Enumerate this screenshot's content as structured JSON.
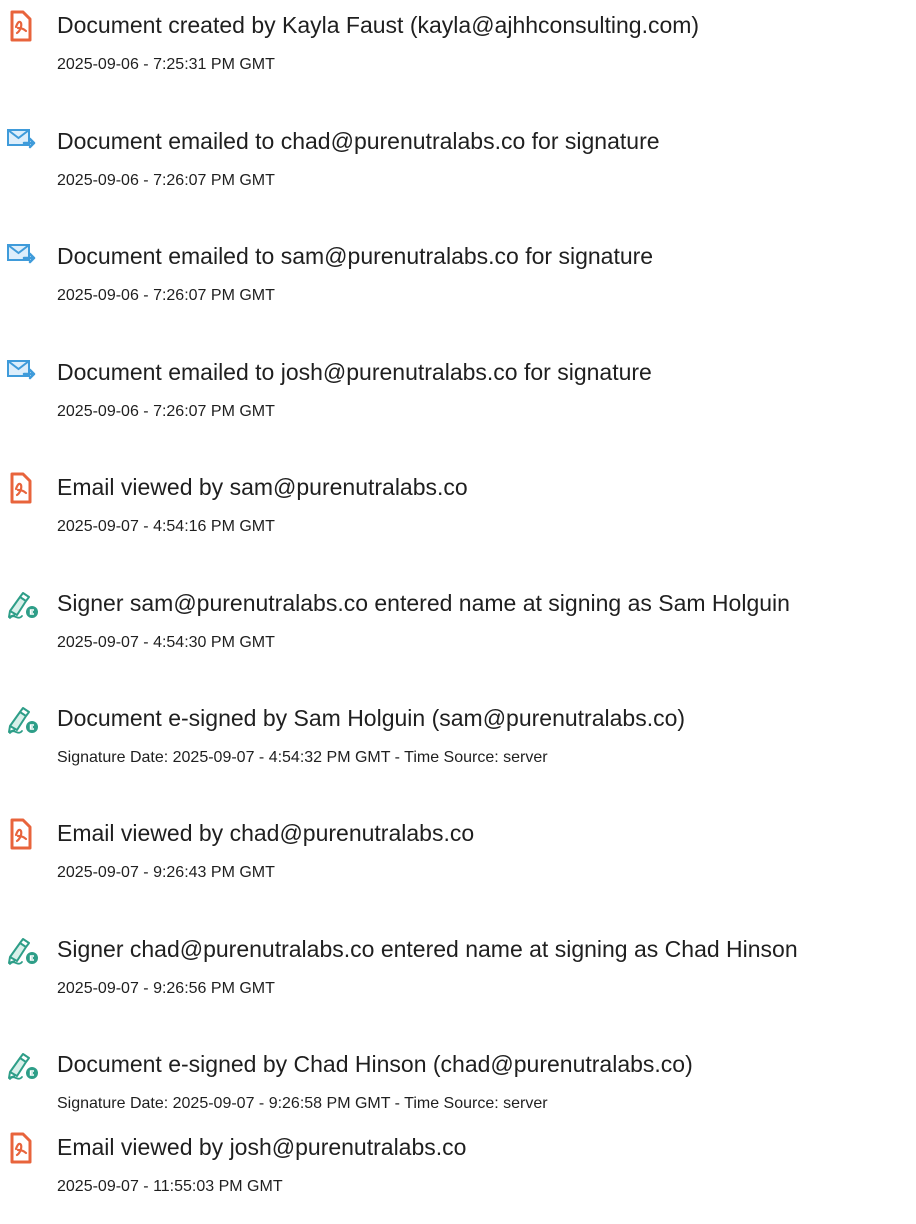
{
  "colors": {
    "doc_icon": "#E8643C",
    "mail_icon": "#3F9BDA",
    "sign_icon": "#2E9E88",
    "text": "#1F1F1F"
  },
  "events": [
    {
      "icon": "document-icon",
      "title": "Document created by Kayla Faust (kayla@ajhhconsulting.com)",
      "timestamp": "2025-09-06 - 7:25:31 PM GMT"
    },
    {
      "icon": "email-sent-icon",
      "title": "Document emailed to chad@purenutralabs.co for signature",
      "timestamp": "2025-09-06 - 7:26:07 PM GMT"
    },
    {
      "icon": "email-sent-icon",
      "title": "Document emailed to sam@purenutralabs.co for signature",
      "timestamp": "2025-09-06 - 7:26:07 PM GMT"
    },
    {
      "icon": "email-sent-icon",
      "title": "Document emailed to josh@purenutralabs.co for signature",
      "timestamp": "2025-09-06 - 7:26:07 PM GMT"
    },
    {
      "icon": "document-icon",
      "title": "Email viewed by sam@purenutralabs.co",
      "timestamp": "2025-09-07 - 4:54:16 PM GMT"
    },
    {
      "icon": "e-sign-pen-icon",
      "title": "Signer sam@purenutralabs.co entered name at signing as Sam Holguin",
      "timestamp": "2025-09-07 - 4:54:30 PM GMT"
    },
    {
      "icon": "e-sign-pen-icon",
      "title": "Document e-signed by Sam Holguin (sam@purenutralabs.co)",
      "timestamp": "Signature Date: 2025-09-07 - 4:54:32 PM GMT - Time Source: server"
    },
    {
      "icon": "document-icon",
      "title": "Email viewed by chad@purenutralabs.co",
      "timestamp": "2025-09-07 - 9:26:43 PM GMT"
    },
    {
      "icon": "e-sign-pen-icon",
      "title": "Signer chad@purenutralabs.co entered name at signing as Chad Hinson",
      "timestamp": "2025-09-07 - 9:26:56 PM GMT"
    },
    {
      "icon": "e-sign-pen-icon",
      "title": "Document e-signed by Chad Hinson (chad@purenutralabs.co)",
      "timestamp": "Signature Date: 2025-09-07 - 9:26:58 PM GMT - Time Source: server"
    },
    {
      "icon": "document-icon",
      "title": "Email viewed by josh@purenutralabs.co",
      "timestamp": "2025-09-07 - 11:55:03 PM GMT"
    }
  ]
}
